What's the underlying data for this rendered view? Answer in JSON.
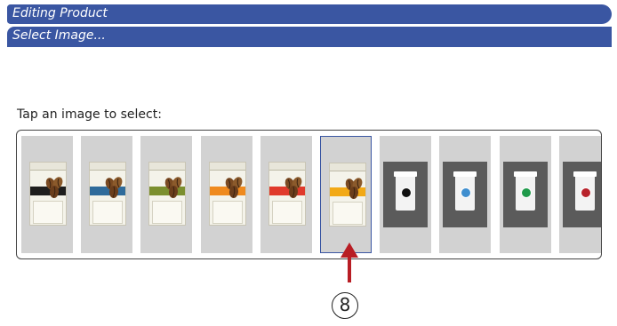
{
  "header": {
    "title": "Editing Product",
    "subtitle": "Select Image..."
  },
  "prompt": "Tap an image to select:",
  "colors": {
    "bar": "#3a56a2",
    "tile": "#d2d2d2",
    "arrow": "#b81d24"
  },
  "images": [
    {
      "kind": "bag",
      "band": "#1e1e1e",
      "selected": false
    },
    {
      "kind": "bag",
      "band": "#2f6b9b",
      "selected": false
    },
    {
      "kind": "bag",
      "band": "#7b8f2f",
      "selected": false
    },
    {
      "kind": "bag",
      "band": "#ef8a1e",
      "selected": false
    },
    {
      "kind": "bag",
      "band": "#e03a2c",
      "selected": false
    },
    {
      "kind": "bag",
      "band": "#f2a916",
      "selected": true
    },
    {
      "kind": "cup",
      "dot": "#111111",
      "selected": false
    },
    {
      "kind": "cup",
      "dot": "#3f8ecf",
      "selected": false
    },
    {
      "kind": "cup",
      "dot": "#1f9a4a",
      "selected": false
    },
    {
      "kind": "cup",
      "dot": "#b8222b",
      "selected": false
    }
  ],
  "callout": "8"
}
